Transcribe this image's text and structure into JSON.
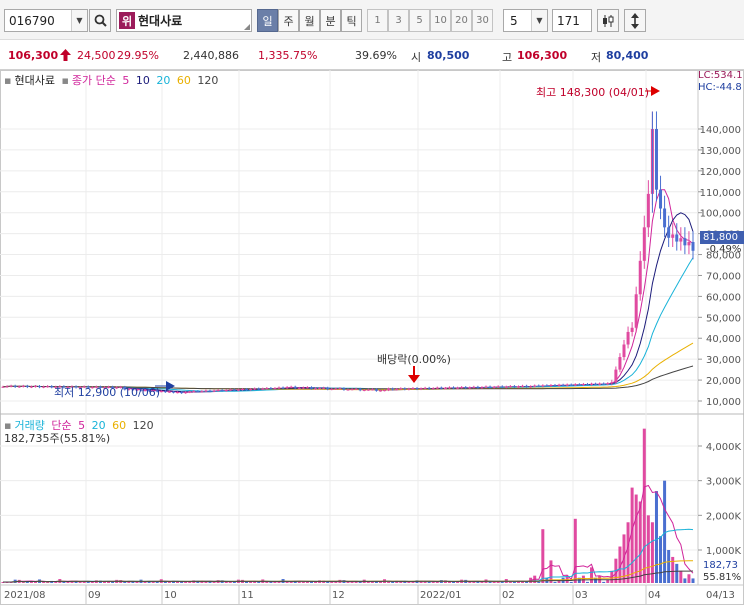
{
  "toolbar": {
    "code": "016790",
    "stock_prefix": "위",
    "stock_name": "현대사료",
    "periods": [
      {
        "label": "일",
        "active": true
      },
      {
        "label": "주",
        "active": false
      },
      {
        "label": "월",
        "active": false
      },
      {
        "label": "분",
        "active": false
      },
      {
        "label": "틱",
        "active": false
      }
    ],
    "numbers": [
      "1",
      "3",
      "5",
      "10",
      "20",
      "30"
    ],
    "interval_value": "5",
    "count_value": "171"
  },
  "price": {
    "current": "106,300",
    "change": "24,500",
    "change_pct": "29.95%",
    "volume": "2,440,886",
    "volume_pct": "1,335.75%",
    "turnover_pct": "39.69%",
    "open_label": "시",
    "open": "80,500",
    "high_label": "고",
    "high": "106,300",
    "low_label": "저",
    "low": "80,400"
  },
  "chart_legend": {
    "name": "현대사료",
    "ma_label": "종가 단순",
    "ma_periods": [
      "5",
      "10",
      "20",
      "60",
      "120"
    ],
    "ma_colors": [
      "#d0259b",
      "#1b1b7a",
      "#19b3d8",
      "#e9b000",
      "#444444"
    ]
  },
  "volume_legend": {
    "name": "거래량",
    "ma_label": "단순",
    "ma_periods": [
      "5",
      "20",
      "60",
      "120"
    ],
    "ma_colors": [
      "#d0259b",
      "#19b3d8",
      "#e9b000",
      "#444444"
    ],
    "current": "182,735주(55.81%)"
  },
  "annotations": {
    "high": "최고 148,300 (04/01)",
    "low": "최저 12,900 (10/06)",
    "dividend": "배당락(0.00%)",
    "lc": "LC:534.1",
    "hc": "HC:-44.8",
    "last_price": "81,800",
    "last_pct": "-0.49%",
    "vol_last": "182,73",
    "vol_pct": "55.81%"
  },
  "colors": {
    "up": "#c0002a",
    "down": "#1f3fa0",
    "candle_up": "#e04aa0",
    "candle_down": "#4a6fd0",
    "ma5": "#d0259b",
    "ma10": "#1b1b7a",
    "ma20": "#19b3d8",
    "ma60": "#e9b000",
    "ma120": "#444444"
  },
  "chart_data": [
    {
      "type": "line",
      "title": "현대사료",
      "y_ticks": [
        10000,
        20000,
        30000,
        40000,
        50000,
        60000,
        70000,
        80000,
        90000,
        100000,
        110000,
        120000,
        130000,
        140000
      ],
      "y_tick_labels": [
        "10,000",
        "20,000",
        "30,000",
        "40,000",
        "50,000",
        "60,000",
        "70,000",
        "80,000",
        "90,000",
        "100,000",
        "110,000",
        "120,000",
        "130,000",
        "140,000"
      ],
      "ylim": [
        4000,
        148300
      ],
      "x_labels": [
        "2021/08",
        "09",
        "10",
        "11",
        "12",
        "2022/01",
        "02",
        "03",
        "04",
        "04/13"
      ],
      "series": [
        {
          "name": "종가",
          "x": [
            "2021/08",
            "09",
            "10",
            "11",
            "12",
            "2022/01",
            "02",
            "03/15",
            "03/25",
            "03/31",
            "04/01",
            "04/05",
            "04/08",
            "04/13"
          ],
          "values": [
            17000,
            16500,
            14000,
            16000,
            13500,
            16000,
            16500,
            17500,
            40000,
            95000,
            140000,
            95000,
            80000,
            81800
          ]
        }
      ],
      "high": {
        "value": 148300,
        "date": "04/01"
      },
      "low": {
        "value": 12900,
        "date": "10/06"
      }
    },
    {
      "type": "bar",
      "title": "거래량",
      "y_ticks": [
        1000,
        2000,
        3000,
        4000
      ],
      "y_tick_labels": [
        "1,000K",
        "2,000K",
        "3,000K",
        "4,000K"
      ],
      "ylim": [
        0,
        4500
      ]
    }
  ]
}
